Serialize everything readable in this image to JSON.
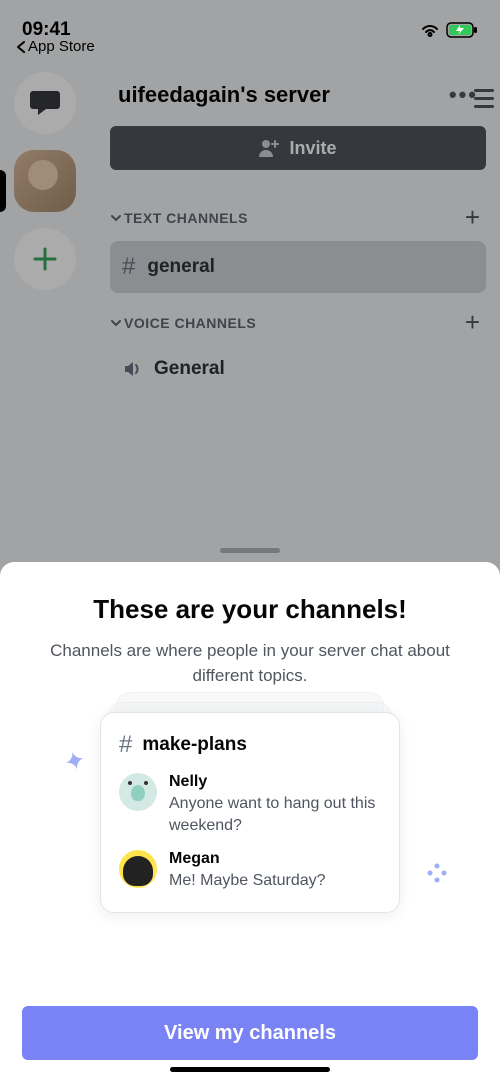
{
  "status": {
    "time": "09:41",
    "back_app": "App Store"
  },
  "server": {
    "name": "uifeedagain's server",
    "invite": "Invite",
    "cat_text": "TEXT CHANNELS",
    "cat_voice": "VOICE CHANNELS",
    "text_channel": "general",
    "voice_channel": "General"
  },
  "sheet": {
    "title": "These are your channels!",
    "sub": "Channels are where people in your server chat about different topics.",
    "card_channel": "make-plans",
    "messages": [
      {
        "name": "Nelly",
        "text": "Anyone want to hang out this weekend?"
      },
      {
        "name": "Megan",
        "text": "Me! Maybe Saturday?"
      }
    ],
    "cta": "View my channels"
  }
}
